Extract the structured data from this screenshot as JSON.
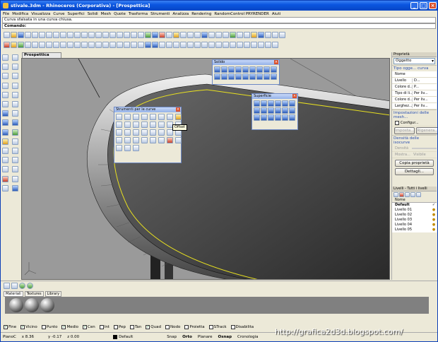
{
  "window": {
    "title": "stivale.3dm - Rhinoceros (Corporativa) - [Prospettica]"
  },
  "menu": [
    "File",
    "Modifica",
    "Visualizza",
    "Curve",
    "Superfici",
    "Solidi",
    "Mesh",
    "Quote",
    "Trasforma",
    "Strumenti",
    "Analizza",
    "Rendering",
    "RandomControl PRYRENDER",
    "Aiuti"
  ],
  "command": {
    "history": "Curva sfalsata in una curva chiusa.",
    "prompt": "Comando:"
  },
  "viewport": {
    "tab": "Prospettica"
  },
  "panels": {
    "solido_title": "Solido",
    "superfici_title": "Superficie",
    "curve_title": "Strumenti per le curve",
    "tooltip": "Offset"
  },
  "properties": {
    "header": "Proprietà",
    "object_type": "Oggetto",
    "section_type": "Tipo ogge... curva",
    "rows": [
      {
        "k": "Nome",
        "v": ""
      },
      {
        "k": "Livello",
        "v": "D..."
      },
      {
        "k": "Colore d...",
        "v": "P..."
      },
      {
        "k": "Tipo di li...",
        "v": "Per liv..."
      },
      {
        "k": "Colore d...",
        "v": "Per liv..."
      },
      {
        "k": "Larghez...",
        "v": "Per liv..."
      }
    ],
    "mesh_section": "Impostazioni delle mesh...",
    "configure": "Configur...",
    "impone": "Imposta...",
    "regen": "Rigenera...",
    "isocurve_section": "Densità delle isocurve",
    "density": "Densità",
    "show": "Mostra...",
    "visible": "Visibile",
    "copy_btn": "Copia proprietà",
    "details_btn": "Dettagli..."
  },
  "layers": {
    "header": "Livelli - Tutti i livelli",
    "col_name": "Nome",
    "items": [
      {
        "name": "Default",
        "current": true
      },
      {
        "name": "Livello 01",
        "current": false
      },
      {
        "name": "Livello 02",
        "current": false
      },
      {
        "name": "Livello 03",
        "current": false
      },
      {
        "name": "Livello 04",
        "current": false
      },
      {
        "name": "Livello 05",
        "current": false
      }
    ]
  },
  "materials": {
    "tabs": [
      "Materiali",
      "Textures",
      "Library"
    ]
  },
  "osnap": [
    {
      "label": "Fine",
      "checked": true
    },
    {
      "label": "Vicino",
      "checked": true
    },
    {
      "label": "Punto",
      "checked": false
    },
    {
      "label": "Medio",
      "checked": true
    },
    {
      "label": "Cen",
      "checked": true
    },
    {
      "label": "Int",
      "checked": false
    },
    {
      "label": "Pep",
      "checked": false
    },
    {
      "label": "Tan",
      "checked": false
    },
    {
      "label": "Quad",
      "checked": true
    },
    {
      "label": "Nodo",
      "checked": false
    },
    {
      "label": "Proietta",
      "checked": false
    },
    {
      "label": "STrack",
      "checked": false
    },
    {
      "label": "Disabilita",
      "checked": false
    }
  ],
  "status": {
    "plane": "PianoC",
    "x": "x 8.36",
    "y": "y -0.17",
    "z": "z 0.00",
    "layer": "Default",
    "snap": "Snap",
    "orto": "Orto",
    "planare": "Planare",
    "osnap": "Osnap",
    "history": "Cronologia"
  },
  "watermark": "http://grafica2d3d.blogspot.com/",
  "colors": {
    "titlebar": "#0a55e0",
    "viewport_bg": "#9a9a9a",
    "curve_yellow": "#e8e020",
    "link_blue": "#2a4fb0"
  }
}
